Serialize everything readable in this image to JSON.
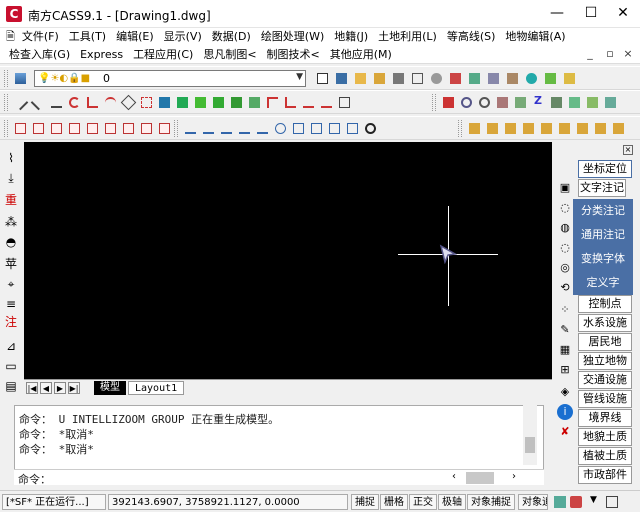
{
  "window": {
    "title": "南方CASS9.1 - [Drawing1.dwg]",
    "logo": "C",
    "controls": [
      "—",
      "☐",
      "✕"
    ]
  },
  "menu1": [
    "文件(F)",
    "工具(T)",
    "编辑(E)",
    "显示(V)",
    "数据(D)",
    "绘图处理(W)",
    "地籍(J)",
    "土地利用(L)",
    "等高线(S)",
    "地物编辑(A)"
  ],
  "menu2": [
    "检查入库(G)",
    "Express",
    "工程应用(C)",
    "思凡制图<",
    "制图技术<",
    "其他应用(M)"
  ],
  "mdi_controls": [
    "_",
    "▫",
    "×"
  ],
  "layer": {
    "value": "0"
  },
  "tabs": {
    "model": "模型",
    "layout": "Layout1"
  },
  "command": {
    "lines": [
      "命令：  U INTELLIZOOM GROUP 正在重生成模型。",
      "命令：  *取消*",
      "命令：  *取消*"
    ],
    "prompt": "命令："
  },
  "status": {
    "state": "[*SF* 正在运行...]",
    "coords": "392143.6907, 3758921.1127, 0.0000",
    "toggles": [
      "捕捉",
      "栅格",
      "正交",
      "极轴",
      "对象捕捉",
      "对象追"
    ]
  },
  "right_panel": {
    "flyout_top": "坐标定位",
    "flyout": [
      "文字注记",
      "分类注记",
      "通用注记",
      "变换字体",
      "定义字"
    ],
    "buttons": [
      "控制点",
      "水系设施",
      "居民地",
      "独立地物",
      "交通设施",
      "管线设施",
      "境界线",
      "地貌土质",
      "植被土质",
      "市政部件"
    ]
  },
  "left_tools": [
    "⌇",
    "⤓",
    "重",
    "⁂",
    "◓",
    "苹",
    "⌖",
    "≡",
    "注",
    "⊿",
    "▭",
    "▤"
  ],
  "colors": {
    "canvas": "#000000",
    "flyout": "#4a6fa5",
    "accent": "#c8102e"
  }
}
